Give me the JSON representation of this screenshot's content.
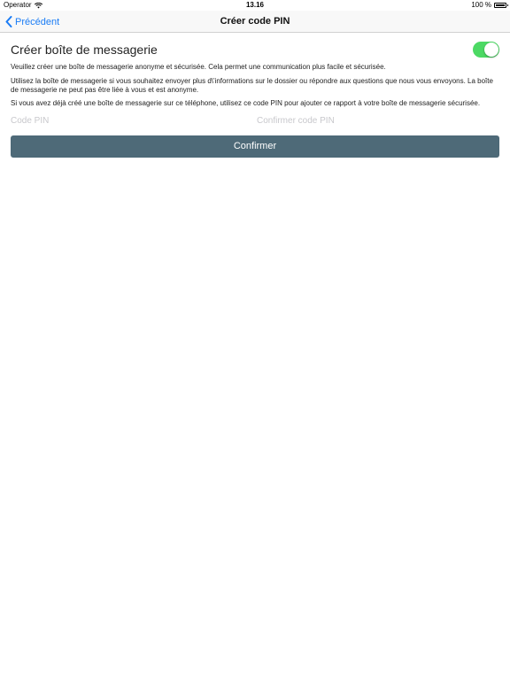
{
  "status_bar": {
    "carrier": "Operator",
    "time": "13.16",
    "battery": "100 %"
  },
  "nav": {
    "back_label": "Précédent",
    "title": "Créer code PIN"
  },
  "section": {
    "heading": "Créer boîte de messagerie",
    "toggle_on": true,
    "paragraphs": [
      "Veuillez créer une boîte de messagerie anonyme et sécurisée. Cela permet une communication plus facile et sécurisée.",
      "Utilisez la boîte de messagerie si vous souhaitez envoyer plus d\\'informations sur le dossier ou répondre aux questions que nous vous envoyons. La boîte de messagerie ne peut pas être liée à vous et est anonyme.",
      "Si vous avez déjà créé une boîte de messagerie sur ce téléphone, utilisez ce code PIN pour ajouter ce rapport à votre boîte de messagerie sécurisée."
    ]
  },
  "pin": {
    "pin_placeholder": "Code PIN",
    "pin_value": "",
    "confirm_placeholder": "Confirmer code PIN",
    "confirm_value": ""
  },
  "confirm_button": {
    "label": "Confirmer"
  },
  "colors": {
    "accent": "#1a7cf5",
    "toggle_on": "#4cd964",
    "button_bg": "#4e6a78"
  }
}
